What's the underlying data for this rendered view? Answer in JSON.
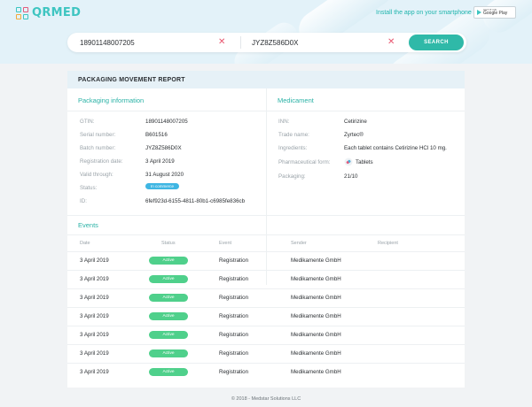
{
  "brand": {
    "name": "QRMED"
  },
  "header": {
    "install_text": "Install the app on your smartphone",
    "store_badge_top": "GET IT ON",
    "store_badge_main": "Google Play"
  },
  "search": {
    "gtin_value": "18901148007205",
    "batch_value": "JYZ8Z586D0X",
    "button_label": "SEARCH"
  },
  "report": {
    "title": "PACKAGING MOVEMENT REPORT",
    "packaging": {
      "title": "Packaging information",
      "rows": [
        {
          "label": "GTIN:",
          "value": "18901148007205"
        },
        {
          "label": "Serial number:",
          "value": "B601516"
        },
        {
          "label": "Batch number:",
          "value": "JYZ8Z586D0X"
        },
        {
          "label": "Registration date:",
          "value": "3 April 2019"
        },
        {
          "label": "Valid through:",
          "value": "31 August 2020"
        },
        {
          "label": "Status:",
          "value": "In commerce"
        },
        {
          "label": "ID:",
          "value": "6fef923d-6155-4811-80b1-c6985fe836cb"
        }
      ]
    },
    "medicament": {
      "title": "Medicament",
      "rows": [
        {
          "label": "INN:",
          "value": "Cetirizine"
        },
        {
          "label": "Trade name:",
          "value": "Zyrtec®"
        },
        {
          "label": "Ingredients:",
          "value": "Each tablet contains Cetirizine HCl 10 mg."
        },
        {
          "label": "Pharmaceutical form:",
          "value": "Tablets"
        },
        {
          "label": "Packaging:",
          "value": "21/10"
        }
      ]
    },
    "events": {
      "title": "Events",
      "columns": [
        "Date",
        "Status",
        "Event",
        "Sender",
        "Recipient"
      ],
      "rows": [
        {
          "date": "3 April 2019",
          "status": "Active",
          "event": "Registration",
          "sender": "Medikamente GmbH",
          "recipient": ""
        },
        {
          "date": "3 April 2019",
          "status": "Active",
          "event": "Registration",
          "sender": "Medikamente GmbH",
          "recipient": ""
        },
        {
          "date": "3 April 2019",
          "status": "Active",
          "event": "Registration",
          "sender": "Medikamente GmbH",
          "recipient": ""
        },
        {
          "date": "3 April 2019",
          "status": "Active",
          "event": "Registration",
          "sender": "Medikamente GmbH",
          "recipient": ""
        },
        {
          "date": "3 April 2019",
          "status": "Active",
          "event": "Registration",
          "sender": "Medikamente GmbH",
          "recipient": ""
        },
        {
          "date": "3 April 2019",
          "status": "Active",
          "event": "Registration",
          "sender": "Medikamente GmbH",
          "recipient": ""
        },
        {
          "date": "3 April 2019",
          "status": "Active",
          "event": "Registration",
          "sender": "Medikamente GmbH",
          "recipient": ""
        }
      ]
    }
  },
  "footer": {
    "text": "© 2018 - Medstar Solutions LLC"
  },
  "colors": {
    "accent": "#2fb9a8",
    "active": "#4fd08b",
    "status_blue": "#3fb6e3",
    "clear": "#e8556e"
  },
  "icons": {
    "clear": "close-icon",
    "form": "tablet-icon",
    "store": "google-play-icon"
  }
}
